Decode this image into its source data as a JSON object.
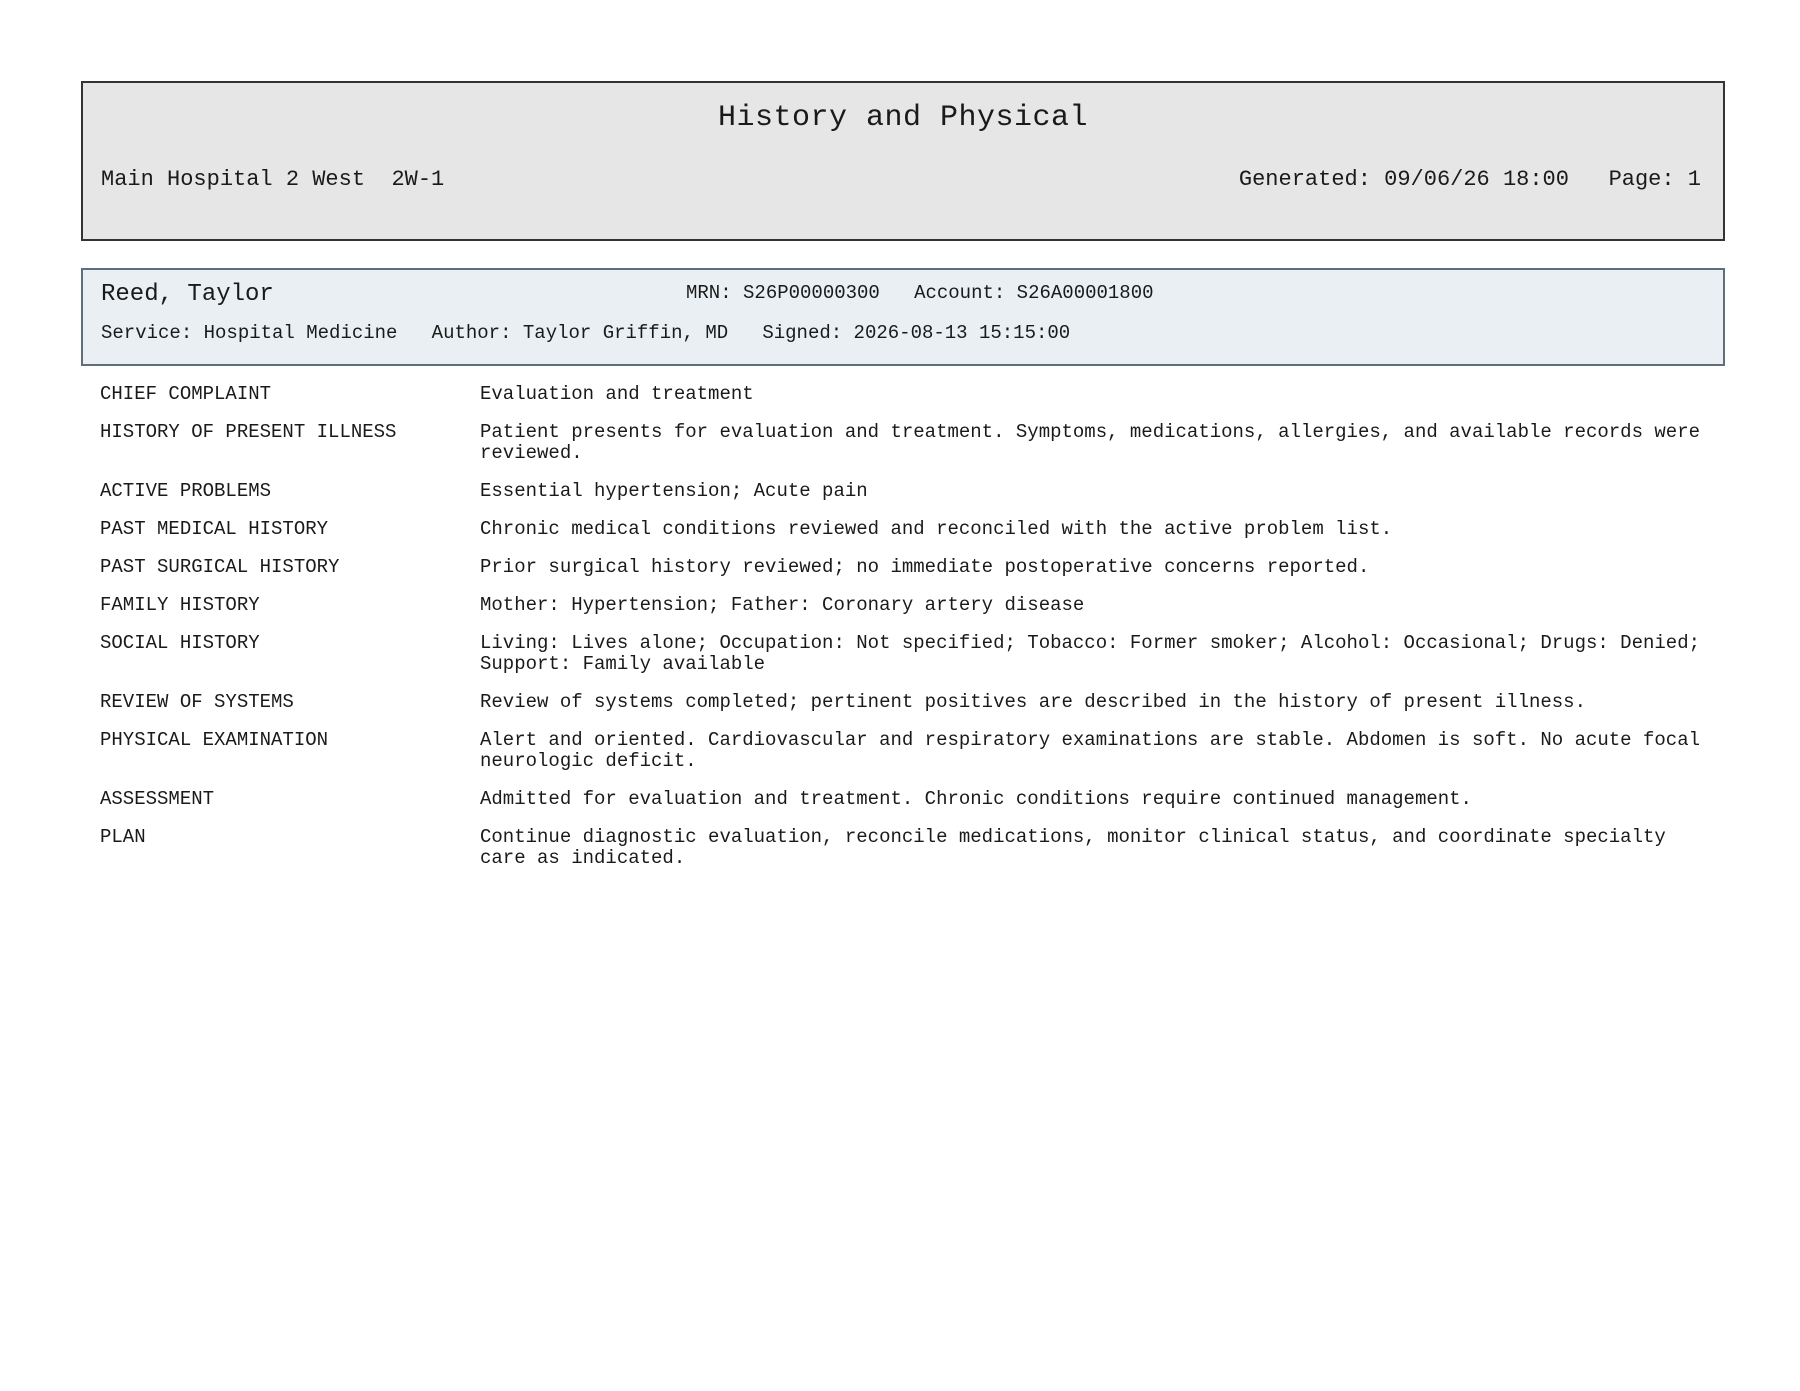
{
  "header": {
    "title": "History and Physical",
    "location": "Main Hospital 2 West  2W-1",
    "generated": "Generated: 09/06/26 18:00",
    "page": "Page: 1"
  },
  "patient": {
    "name": "Reed, Taylor",
    "mrn": "MRN: S26P00000300",
    "account": "Account: S26A00001800",
    "service": "Service: Hospital Medicine",
    "author": "Author: Taylor Griffin, MD",
    "signed": "Signed: 2026-08-13 15:15:00"
  },
  "sections": [
    {
      "label": "CHIEF COMPLAINT",
      "text": "Evaluation and treatment"
    },
    {
      "label": "HISTORY OF PRESENT ILLNESS",
      "text": "Patient presents for evaluation and treatment. Symptoms, medications, allergies, and available records were reviewed."
    },
    {
      "label": "ACTIVE PROBLEMS",
      "text": "Essential hypertension; Acute pain"
    },
    {
      "label": "PAST MEDICAL HISTORY",
      "text": "Chronic medical conditions reviewed and reconciled with the active problem list."
    },
    {
      "label": "PAST SURGICAL HISTORY",
      "text": "Prior surgical history reviewed; no immediate postoperative concerns reported."
    },
    {
      "label": "FAMILY HISTORY",
      "text": "Mother: Hypertension; Father: Coronary artery disease"
    },
    {
      "label": "SOCIAL HISTORY",
      "text": "Living: Lives alone; Occupation: Not specified; Tobacco: Former smoker; Alcohol: Occasional; Drugs: Denied; Support: Family available"
    },
    {
      "label": "REVIEW OF SYSTEMS",
      "text": "Review of systems completed; pertinent positives are described in the history of present illness."
    },
    {
      "label": "PHYSICAL EXAMINATION",
      "text": "Alert and oriented. Cardiovascular and respiratory examinations are stable. Abdomen is soft. No acute focal neurologic deficit."
    },
    {
      "label": "ASSESSMENT",
      "text": "Admitted for evaluation and treatment. Chronic conditions require continued management."
    },
    {
      "label": "PLAN",
      "text": "Continue diagnostic evaluation, reconcile medications, monitor clinical status, and coordinate specialty care as indicated."
    }
  ]
}
